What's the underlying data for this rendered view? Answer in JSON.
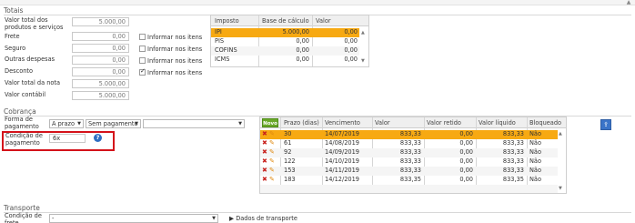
{
  "totais": {
    "title": "Totais",
    "fields": [
      {
        "label": "Valor total dos produtos e serviços",
        "value": "5.000,00"
      },
      {
        "label": "Frete",
        "value": "0,00"
      },
      {
        "label": "Seguro",
        "value": "0,00"
      },
      {
        "label": "Outras despesas",
        "value": "0,00"
      },
      {
        "label": "Desconto",
        "value": "0,00"
      },
      {
        "label": "Valor total da nota",
        "value": "5.000,00"
      },
      {
        "label": "Valor contábil",
        "value": "5.000,00"
      }
    ],
    "checkboxes": [
      {
        "label": "Informar nos itens",
        "checked": false
      },
      {
        "label": "Informar nos itens",
        "checked": false
      },
      {
        "label": "Informar nos itens",
        "checked": false
      },
      {
        "label": "Informar nos itens",
        "checked": true
      }
    ],
    "imposto_grid": {
      "headers": [
        "Imposto",
        "Base de cálculo",
        "Valor"
      ],
      "rows": [
        [
          "IPI",
          "5.000,00",
          "0,00"
        ],
        [
          "PIS",
          "0,00",
          "0,00"
        ],
        [
          "COFINS",
          "0,00",
          "0,00"
        ],
        [
          "ICMS",
          "0,00",
          "0,00"
        ]
      ]
    }
  },
  "cobranca": {
    "title": "Cobrança",
    "forma_label": "Forma de pagamento",
    "forma_value": "A prazo",
    "sem_pagamento": "Sem pagamento",
    "extra_select": "",
    "condicao_label": "Condição de pagamento",
    "condicao_value": "6x",
    "help_icon": "?",
    "novo_label": "Novo",
    "parcelas_grid": {
      "headers": [
        "Prazo (dias)",
        "Vencimento",
        "Valor",
        "Valor retido",
        "Valor líquido",
        "Bloqueado"
      ],
      "rows": [
        [
          "30",
          "14/07/2019",
          "833,33",
          "0,00",
          "833,33",
          "Não"
        ],
        [
          "61",
          "14/08/2019",
          "833,33",
          "0,00",
          "833,33",
          "Não"
        ],
        [
          "92",
          "14/09/2019",
          "833,33",
          "0,00",
          "833,33",
          "Não"
        ],
        [
          "122",
          "14/10/2019",
          "833,33",
          "0,00",
          "833,33",
          "Não"
        ],
        [
          "153",
          "14/11/2019",
          "833,33",
          "0,00",
          "833,33",
          "Não"
        ],
        [
          "183",
          "14/12/2019",
          "833,35",
          "0,00",
          "833,35",
          "Não"
        ]
      ]
    }
  },
  "transporte": {
    "title": "Transporte",
    "condicao_label": "Condição de frete",
    "condicao_value": "-",
    "dados_link": "Dados de transporte"
  },
  "colors": {
    "selected_row": "#f7a912",
    "highlight_border": "#d4121a",
    "novo_button": "#6aa82a"
  }
}
